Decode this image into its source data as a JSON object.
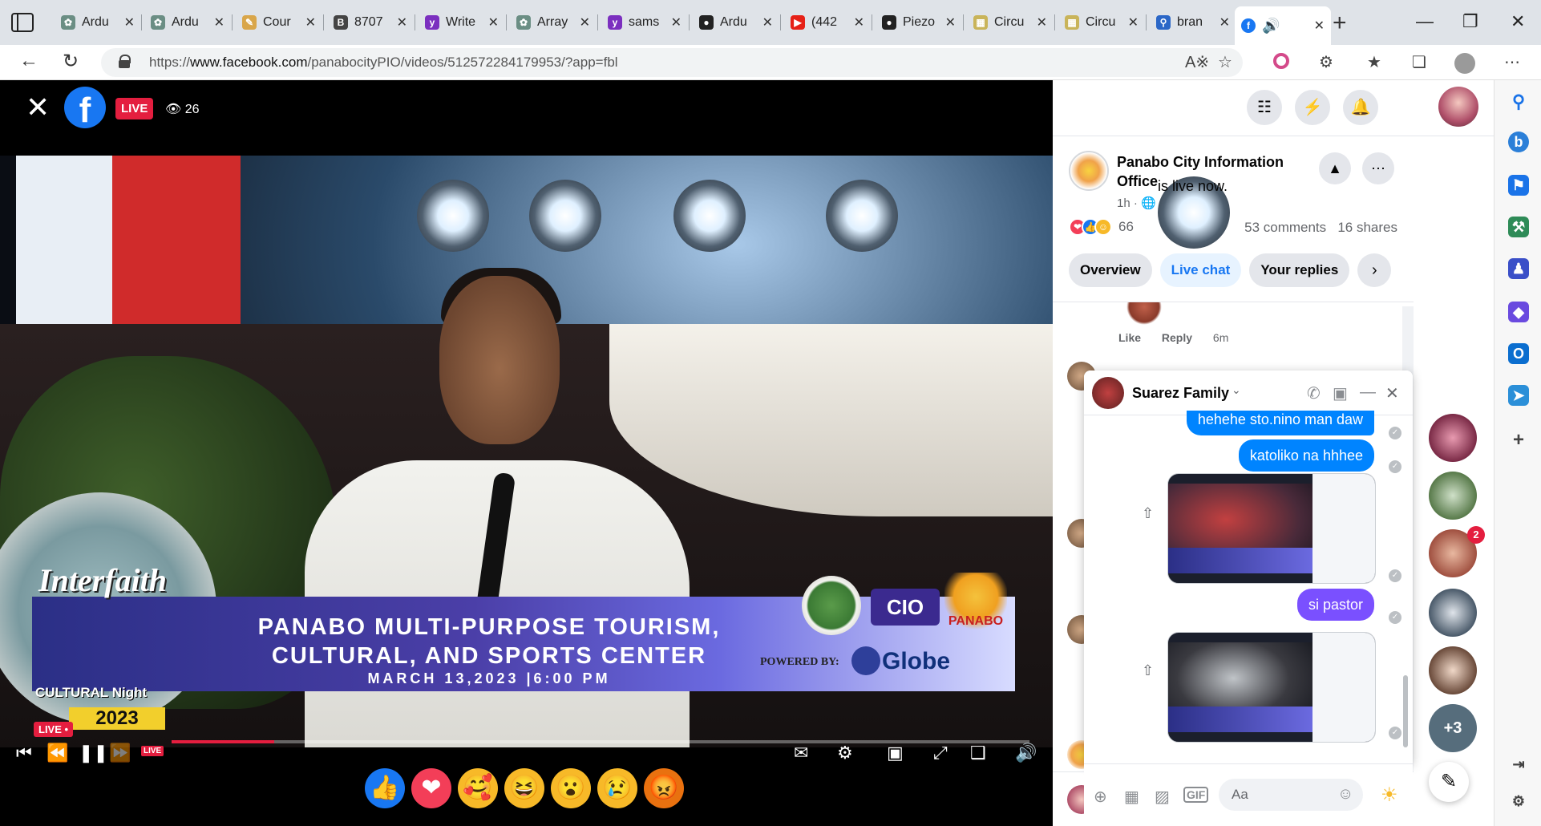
{
  "browser": {
    "tabs": [
      {
        "label": "Ardu",
        "favicon": "openai-icon",
        "color": "#6b8e84"
      },
      {
        "label": "Ardu",
        "favicon": "openai-icon",
        "color": "#6b8e84"
      },
      {
        "label": "Cour",
        "favicon": "pencil-icon",
        "color": "#d9a64a"
      },
      {
        "label": "8707",
        "favicon": "bb-icon",
        "color": "#444444"
      },
      {
        "label": "Write",
        "favicon": "yahoo-icon",
        "color": "#7b2fbf"
      },
      {
        "label": "Array",
        "favicon": "openai-icon",
        "color": "#6b8e84"
      },
      {
        "label": "sams",
        "favicon": "yahoo-icon",
        "color": "#7b2fbf"
      },
      {
        "label": "Ardu",
        "favicon": "github-icon",
        "color": "#222222"
      },
      {
        "label": "(442",
        "favicon": "youtube-icon",
        "color": "#e62117"
      },
      {
        "label": "Piezo",
        "favicon": "github-icon",
        "color": "#222222"
      },
      {
        "label": "Circu",
        "favicon": "grid-icon",
        "color": "#c9b45a"
      },
      {
        "label": "Circu",
        "favicon": "grid-icon",
        "color": "#c9b45a"
      },
      {
        "label": "bran",
        "favicon": "search-icon",
        "color": "#2b67c7"
      }
    ],
    "active_tab": {
      "favicon": "facebook-icon",
      "color": "#1877f2"
    },
    "url_prefix": "https://",
    "url_domain": "www.facebook.com",
    "url_path": "/panabocityPIO/videos/512572284179953/?app=fbl"
  },
  "video": {
    "live_label": "LIVE",
    "viewer_count": "26",
    "banner_title": "PANABO MULTI-PURPOSE TOURISM, CULTURAL, AND SPORTS CENTER",
    "banner_date": "MARCH 13,2023 |6:00 PM",
    "powered_by": "POWERED BY:",
    "sponsor": "Globe",
    "event_title": "Interfaith",
    "event_sub": "CULTURAL Night",
    "event_year": "2023",
    "live_small": "LIVE •",
    "cio_logo": "CIO",
    "panabo_logo": "PANABO",
    "controls_live": "LIVE",
    "progress": 0.12
  },
  "post": {
    "page_name": "Panabo City Information Office",
    "status_text": "is live now.",
    "time": "1h ·",
    "reaction_count": "66",
    "comments_count": "53 comments",
    "shares_count": "16 shares",
    "tabs": [
      "Overview",
      "Live chat",
      "Your replies"
    ],
    "comment_actions": {
      "like": "Like",
      "reply": "Reply",
      "time": "6m"
    }
  },
  "chat": {
    "name": "Suarez Family",
    "messages": [
      {
        "text": "katoliko na hhhee"
      },
      {
        "text": "si pastor"
      }
    ],
    "partial_message": "hehehe sto.nino man daw",
    "input_placeholder": "Aa"
  },
  "contacts": {
    "badge": "2",
    "more": "+3"
  }
}
